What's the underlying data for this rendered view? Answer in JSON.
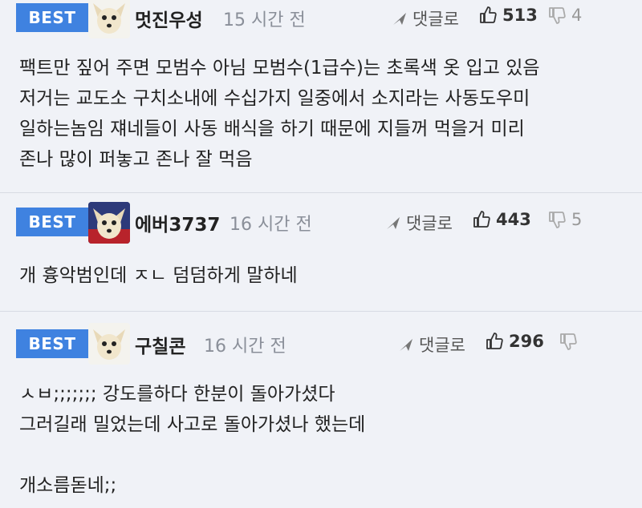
{
  "comments": [
    {
      "badge": "BEST",
      "nickname": "멋진우성",
      "time": "15 시간 전",
      "reply_label": "댓글로",
      "likes": "513",
      "dislikes": "4",
      "text": "팩트만 짚어 주면 모범수 아님 모범수(1급수)는 초록색 옷 입고 있음\n저거는 교도소 구치소내에 수십가지 일중에서 소지라는 사동도우미\n일하는놈임 쟤네들이 사동 배식을 하기 때문에 지들꺼 먹을거 미리\n존나 많이 퍼놓고 존나 잘 먹음"
    },
    {
      "badge": "BEST",
      "nickname": "에버3737",
      "time": "16 시간 전",
      "reply_label": "댓글로",
      "likes": "443",
      "dislikes": "5",
      "text": "개 흉악범인데 ㅈㄴ 덤덤하게 말하네"
    },
    {
      "badge": "BEST",
      "nickname": "구칠콘",
      "time": "16 시간 전",
      "reply_label": "댓글로",
      "likes": "296",
      "dislikes": "",
      "text": "ㅅㅂ;;;;;;; 강도를하다 한분이 돌아가셨다\n그러길래 밀었는데 사고로 돌아가셨나 했는데\n\n개소름돋네;;"
    }
  ],
  "colors": {
    "badge": "#3f82e0",
    "background": "#f0f2f7"
  },
  "icons": {
    "reply": "share-arrow-icon",
    "like": "thumbs-up-icon",
    "dislike": "thumbs-down-icon",
    "avatar": "dog-avatar-icon"
  }
}
